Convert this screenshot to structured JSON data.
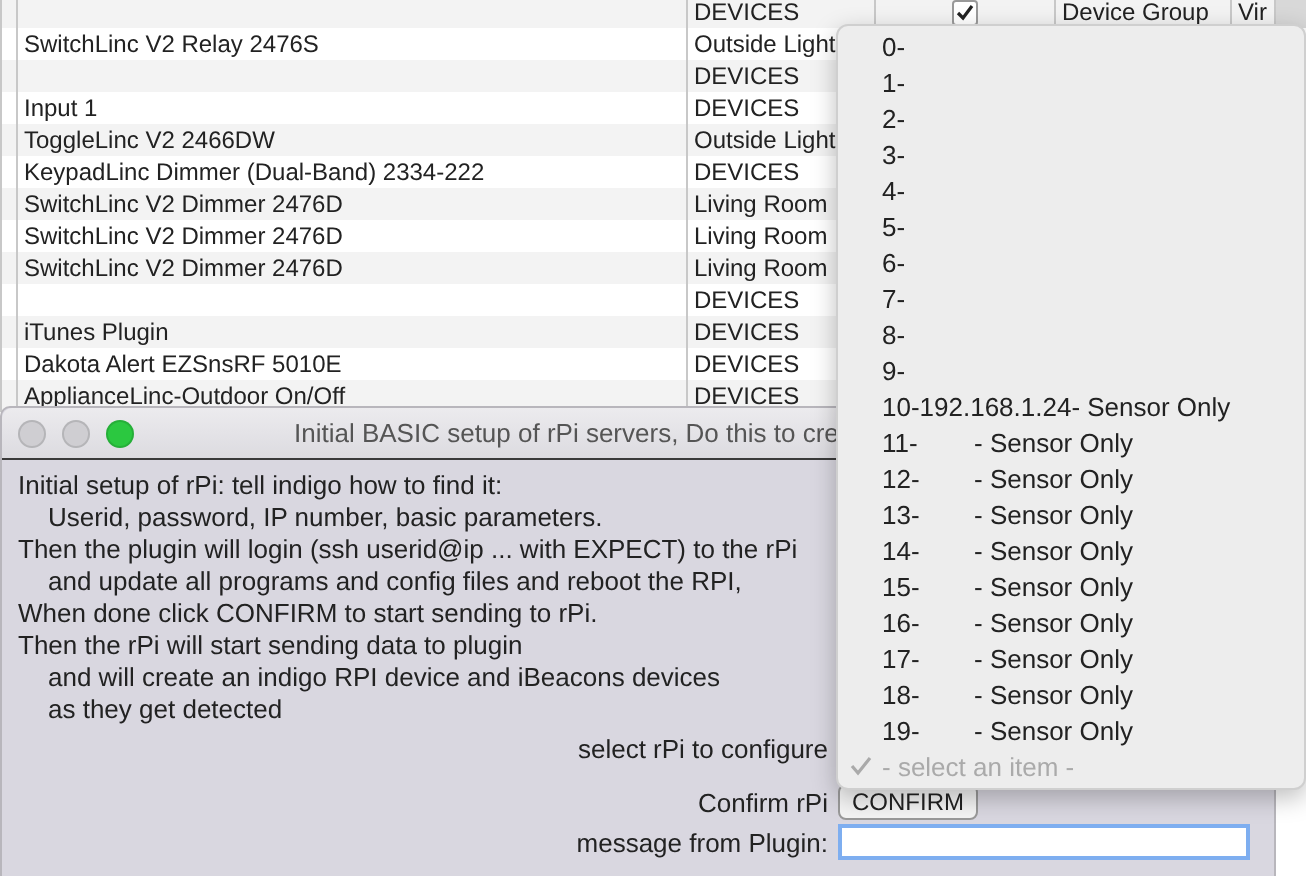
{
  "table": {
    "first_row": {
      "folder": "DEVICES",
      "checked": true,
      "column_4": "Device Group",
      "column_5": "Vir"
    },
    "rows": [
      {
        "name": "SwitchLinc V2 Relay 2476S",
        "folder": "Outside Light"
      },
      {
        "folder": "DEVICES"
      },
      {
        "name": "Input 1",
        "folder": "DEVICES"
      },
      {
        "name": "ToggleLinc V2 2466DW",
        "folder": "Outside Light"
      },
      {
        "name": "KeypadLinc Dimmer (Dual-Band) 2334-222",
        "folder": "DEVICES"
      },
      {
        "name": "SwitchLinc V2 Dimmer 2476D",
        "folder": "Living Room"
      },
      {
        "name": "SwitchLinc V2 Dimmer 2476D",
        "folder": "Living Room"
      },
      {
        "name": "SwitchLinc V2 Dimmer 2476D",
        "folder": "Living Room"
      },
      {
        "folder": "DEVICES"
      },
      {
        "name": "iTunes Plugin",
        "folder": "DEVICES"
      },
      {
        "name": "Dakota Alert EZSnsRF 5010E",
        "folder": "DEVICES"
      },
      {
        "name": "ApplianceLinc-Outdoor On/Off",
        "folder": "DEVICES"
      }
    ]
  },
  "dialog": {
    "title": "Initial BASIC setup of rPi servers, Do this to cre",
    "lines": [
      {
        "text": "Initial setup of rPi: tell indigo how to find it:",
        "indented": false
      },
      {
        "text": "Userid, password, IP number, basic parameters.",
        "indented": true
      },
      {
        "text": "Then the plugin will login (ssh userid@ip ... with EXPECT) to the rPi",
        "indented": false
      },
      {
        "text": "and update all programs and config files and reboot the RPI,",
        "indented": true
      },
      {
        "text": "When done click  CONFIRM to start sending to rPi.",
        "indented": false
      },
      {
        "text": "Then the rPi will start sending data to plugin",
        "indented": false
      },
      {
        "text": "and will create an indigo RPI device and iBeacons devices",
        "indented": true
      },
      {
        "text": "as they get detected",
        "indented": true
      }
    ],
    "select_label": "select rPi to configure",
    "confirm_label": "Confirm rPi",
    "confirm_button": "CONFIRM",
    "message_label": "message from Plugin:"
  },
  "menu": {
    "items": [
      {
        "label": "0-",
        "selected": false
      },
      {
        "label": "1-",
        "selected": false
      },
      {
        "label": "2-",
        "selected": false
      },
      {
        "label": "3-",
        "selected": false
      },
      {
        "label": "4-",
        "selected": false
      },
      {
        "label": "5-",
        "selected": false
      },
      {
        "label": "6-",
        "selected": false
      },
      {
        "label": "7-",
        "selected": false
      },
      {
        "label": "8-",
        "selected": false
      },
      {
        "label": "9-",
        "selected": false
      },
      {
        "label": "10-192.168.1.24- Sensor Only",
        "selected": false
      },
      {
        "label": "11-",
        "detail": "- Sensor Only",
        "selected": false
      },
      {
        "label": "12-",
        "detail": "- Sensor Only",
        "selected": false
      },
      {
        "label": "13-",
        "detail": "- Sensor Only",
        "selected": false
      },
      {
        "label": "14-",
        "detail": "- Sensor Only",
        "selected": false
      },
      {
        "label": "15-",
        "detail": "- Sensor Only",
        "selected": false
      },
      {
        "label": "16-",
        "detail": "- Sensor Only",
        "selected": false
      },
      {
        "label": "17-",
        "detail": "- Sensor Only",
        "selected": false
      },
      {
        "label": "18-",
        "detail": "- Sensor Only",
        "selected": false
      },
      {
        "label": "19-",
        "detail": "- Sensor Only",
        "selected": false
      },
      {
        "label": "- select an item -",
        "selected": true,
        "disabled": true
      }
    ]
  }
}
